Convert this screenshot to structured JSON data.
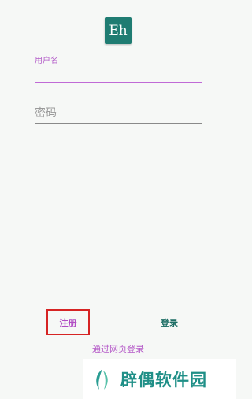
{
  "app": {
    "logo_text": "Eh"
  },
  "form": {
    "username_label": "用户名",
    "username_value": "",
    "password_placeholder": "密码",
    "password_value": ""
  },
  "actions": {
    "register_label": "注册",
    "login_label": "登录",
    "web_login_label": "通过网页登录"
  },
  "watermark": {
    "text": "辟偶软件园"
  },
  "colors": {
    "accent": "#c06ad6",
    "brand": "#1f7c72",
    "highlight_box": "#d62424",
    "background": "#f6f8f6"
  }
}
